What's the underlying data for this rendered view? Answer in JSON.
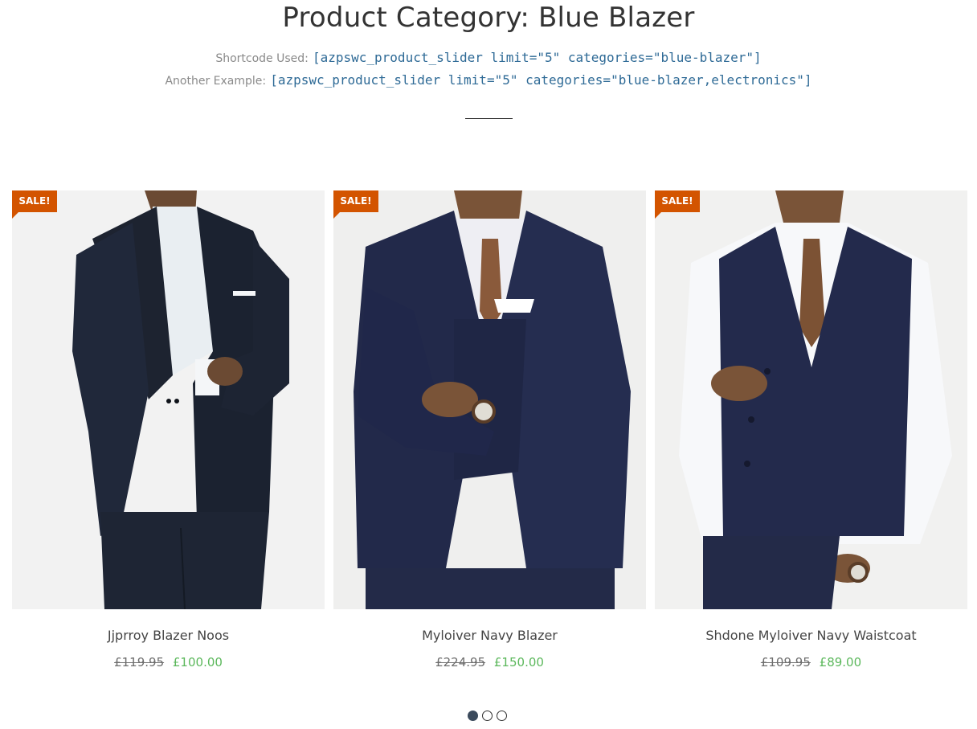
{
  "page": {
    "title": "Product Category: Blue Blazer",
    "shortcode_label": "Shortcode Used:",
    "shortcode_value": "[azpswc_product_slider limit=\"5\" categories=\"blue-blazer\"]",
    "example_label": "Another Example:",
    "example_value": "[azpswc_product_slider limit=\"5\" categories=\"blue-blazer,electronics\"]"
  },
  "products": [
    {
      "badge": "SALE!",
      "name": "Jjprroy Blazer Noos",
      "old_price": "£119.95",
      "new_price": "£100.00",
      "image_alt": "man in dark navy slim suit"
    },
    {
      "badge": "SALE!",
      "name": "Myloiver Navy Blazer",
      "old_price": "£224.95",
      "new_price": "£150.00",
      "image_alt": "man in navy three-piece blazer with brown tie"
    },
    {
      "badge": "SALE!",
      "name": "Shdone Myloiver Navy Waistcoat",
      "old_price": "£109.95",
      "new_price": "£89.00",
      "image_alt": "man in navy waistcoat and white shirt"
    }
  ],
  "slider": {
    "pages": 3,
    "active_page": 1
  },
  "colors": {
    "badge": "#d35400",
    "sale_price": "#5cb85c",
    "shortcode": "#2e6a96"
  }
}
